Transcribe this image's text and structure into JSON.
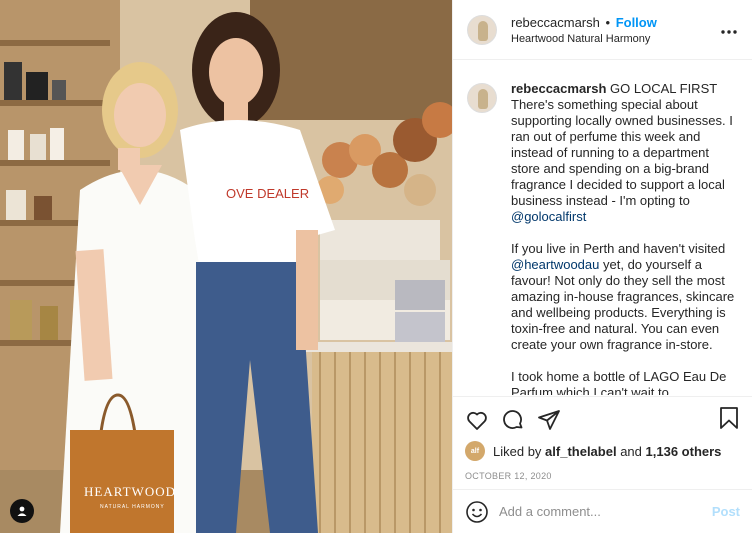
{
  "post": {
    "username": "rebeccacmarsh",
    "dot": "•",
    "follow_label": "Follow",
    "location": "Heartwood Natural Harmony",
    "more_icon": "more-options-icon"
  },
  "caption": {
    "paragraph1": "GO LOCAL FIRST There's something special about supporting locally owned businesses. I ran out of perfume this week and instead of running to a department store and spending on a big-brand fragrance I decided to support a local business instead - I'm opting to",
    "mention1": "@golocalfirst",
    "paragraph2_before": "If you live in Perth and haven't visited",
    "mention2": "@heartwoodau",
    "paragraph2_after": "yet, do yourself a favour! Not only do they sell the most amazing in-house fragrances, skincare and wellbeing products. Everything is toxin-free and natural. You can even create your own fragrance in-store.",
    "paragraph3": "I took home a bottle of LAGO Eau De Parfum which I can't wait to"
  },
  "photo": {
    "shirt_text": "OVE DEALER",
    "bag_brand": "HEARTWOOD",
    "bag_sub": "NATURAL HARMONY"
  },
  "likes": {
    "prefix": "Liked by",
    "liker": "alf_thelabel",
    "liker_avatar_text": "alf",
    "middle": "and",
    "others": "1,136 others"
  },
  "date": "OCTOBER 12, 2020",
  "comment": {
    "placeholder": "Add a comment...",
    "post_label": "Post"
  },
  "colors": {
    "accent": "#0095f6",
    "mention": "#00376b",
    "post_disabled": "#b2dffc"
  }
}
